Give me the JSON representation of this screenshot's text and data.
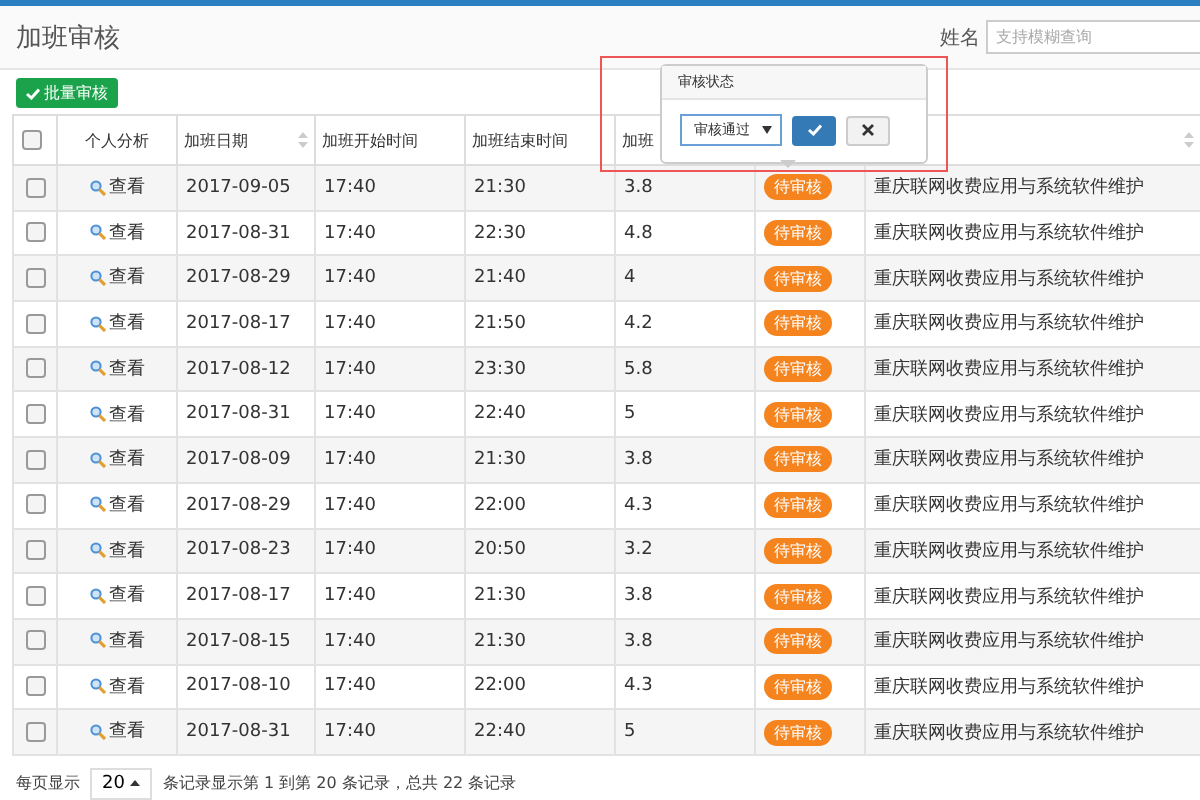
{
  "page_title": "加班审核",
  "search": {
    "label": "姓名",
    "placeholder": "支持模糊查询"
  },
  "batch_button": {
    "label": "批量审核"
  },
  "select_all": {
    "checked": false
  },
  "columns": [
    {
      "kind": "check"
    },
    {
      "kind": "text",
      "label": "个人分析",
      "sortable": false
    },
    {
      "kind": "text",
      "label": "加班日期",
      "sortable": true
    },
    {
      "kind": "text",
      "label": "加班开始时间",
      "sortable": false
    },
    {
      "kind": "text",
      "label": "加班结束时间",
      "sortable": false
    },
    {
      "kind": "text",
      "label": "加班"
    },
    {
      "kind": "blank"
    },
    {
      "kind": "blank",
      "sortable": true
    }
  ],
  "rows": [
    {
      "checked": false,
      "view": "查看",
      "date": "2017-09-05",
      "start": "17:40",
      "end": "21:30",
      "hours": "3.8",
      "status": "待审核",
      "project": "重庆联网收费应用与系统软件维护"
    },
    {
      "checked": false,
      "view": "查看",
      "date": "2017-08-31",
      "start": "17:40",
      "end": "22:30",
      "hours": "4.8",
      "status": "待审核",
      "project": "重庆联网收费应用与系统软件维护"
    },
    {
      "checked": false,
      "view": "查看",
      "date": "2017-08-29",
      "start": "17:40",
      "end": "21:40",
      "hours": "4",
      "status": "待审核",
      "project": "重庆联网收费应用与系统软件维护"
    },
    {
      "checked": false,
      "view": "查看",
      "date": "2017-08-17",
      "start": "17:40",
      "end": "21:50",
      "hours": "4.2",
      "status": "待审核",
      "project": "重庆联网收费应用与系统软件维护"
    },
    {
      "checked": false,
      "view": "查看",
      "date": "2017-08-12",
      "start": "17:40",
      "end": "23:30",
      "hours": "5.8",
      "status": "待审核",
      "project": "重庆联网收费应用与系统软件维护"
    },
    {
      "checked": false,
      "view": "查看",
      "date": "2017-08-31",
      "start": "17:40",
      "end": "22:40",
      "hours": "5",
      "status": "待审核",
      "project": "重庆联网收费应用与系统软件维护"
    },
    {
      "checked": false,
      "view": "查看",
      "date": "2017-08-09",
      "start": "17:40",
      "end": "21:30",
      "hours": "3.8",
      "status": "待审核",
      "project": "重庆联网收费应用与系统软件维护"
    },
    {
      "checked": false,
      "view": "查看",
      "date": "2017-08-29",
      "start": "17:40",
      "end": "22:00",
      "hours": "4.3",
      "status": "待审核",
      "project": "重庆联网收费应用与系统软件维护"
    },
    {
      "checked": false,
      "view": "查看",
      "date": "2017-08-23",
      "start": "17:40",
      "end": "20:50",
      "hours": "3.2",
      "status": "待审核",
      "project": "重庆联网收费应用与系统软件维护"
    },
    {
      "checked": false,
      "view": "查看",
      "date": "2017-08-17",
      "start": "17:40",
      "end": "21:30",
      "hours": "3.8",
      "status": "待审核",
      "project": "重庆联网收费应用与系统软件维护"
    },
    {
      "checked": false,
      "view": "查看",
      "date": "2017-08-15",
      "start": "17:40",
      "end": "21:30",
      "hours": "3.8",
      "status": "待审核",
      "project": "重庆联网收费应用与系统软件维护"
    },
    {
      "checked": false,
      "view": "查看",
      "date": "2017-08-10",
      "start": "17:40",
      "end": "22:00",
      "hours": "4.3",
      "status": "待审核",
      "project": "重庆联网收费应用与系统软件维护"
    },
    {
      "checked": false,
      "view": "查看",
      "date": "2017-08-31",
      "start": "17:40",
      "end": "22:40",
      "hours": "5",
      "status": "待审核",
      "project": "重庆联网收费应用与系统软件维护"
    }
  ],
  "popover": {
    "title": "审核状态",
    "select_value": "审核通过"
  },
  "footer": {
    "per_page_label": "每页显示",
    "per_page": "20",
    "summary": "条记录显示第 1 到第 20 条记录，总共 22 条记录"
  }
}
